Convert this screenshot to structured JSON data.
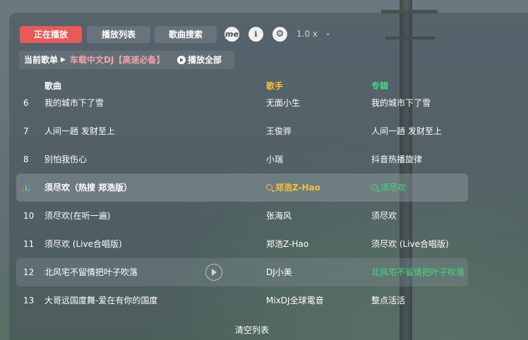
{
  "toolbar": {
    "tabs": [
      "正在播放",
      "播放列表",
      "歌曲搜索"
    ],
    "me_label": "me",
    "info_label": "i",
    "settings_label": "⚙",
    "playback_rate": "1.0 x",
    "rate_chevron": "⌄"
  },
  "current": {
    "label": "当前歌单",
    "song": "车载中文DJ【高速必备】",
    "play_all": "播放全部"
  },
  "headers": {
    "song": "歌曲",
    "artist": "歌手",
    "album": "专辑"
  },
  "rows": [
    {
      "index": "6",
      "title": "我的城市下了雪",
      "artist": "无面小生",
      "album": "我的城市下了雪"
    },
    {
      "index": "7",
      "title": "人间一趟 发财至上",
      "artist": "王俊骅",
      "album": "人间一趟 发财至上"
    },
    {
      "index": "8",
      "title": "别怕我伤心",
      "artist": "小瑞",
      "album": "抖音热播旋律"
    },
    {
      "index": "",
      "title": "须尽欢（热搜 郑浩版）",
      "artist": "郑浩Z-Hao",
      "album": "须尽欢"
    },
    {
      "index": "10",
      "title": "须尽欢(在听一遍)",
      "artist": "张海风",
      "album": "须尽欢"
    },
    {
      "index": "11",
      "title": "须尽欢 (Live合唱版)",
      "artist": "郑浩Z-Hao",
      "album": "须尽欢 (Live合唱版)"
    },
    {
      "index": "12",
      "title": "北风宅不留情把叶子吹落",
      "artist": "DJ小美",
      "album": "北风宅不留情把叶子吹落"
    },
    {
      "index": "13",
      "title": "大哥远国度舞-爱在有你的国度",
      "artist": "MixDJ全球電音",
      "album": "整点活活"
    }
  ],
  "footer": {
    "clear_label": "清空列表"
  },
  "colors": {
    "accent_red": "#e85a58",
    "artist_yellow": "#f3c136",
    "album_green": "#3ddc84",
    "current_song_pink": "#f3a3a3"
  }
}
